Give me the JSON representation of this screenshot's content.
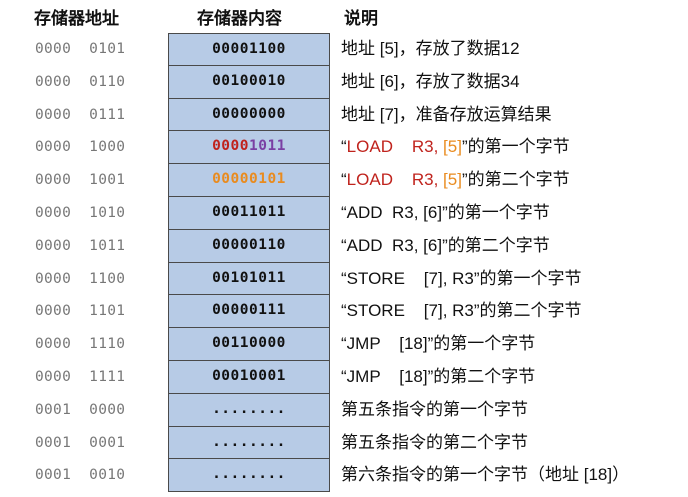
{
  "headers": {
    "address": "存储器地址",
    "content": "存储器内容",
    "description": "说明"
  },
  "rows": [
    {
      "addr": "0000  0101",
      "content": [
        "00001100"
      ],
      "desc": [
        "地址 [5]，存放了数据12"
      ]
    },
    {
      "addr": "0000  0110",
      "content": [
        "00100010"
      ],
      "desc": [
        "地址 [6]，存放了数据34"
      ]
    },
    {
      "addr": "0000  0111",
      "content": [
        "00000000"
      ],
      "desc": [
        "地址 [7]，准备存放运算结果"
      ]
    },
    {
      "addr": "0000  1000",
      "content": [
        "0000",
        "1011"
      ],
      "desc": [
        "“",
        "LOAD    R3, ",
        "[5]",
        "”的第一个字节"
      ]
    },
    {
      "addr": "0000  1001",
      "content": [
        "00000101"
      ],
      "desc": [
        "“",
        "LOAD    R3, ",
        "[5]",
        "”的第二个字节"
      ]
    },
    {
      "addr": "0000  1010",
      "content": [
        "00011011"
      ],
      "desc": [
        "“ADD  R3, [6]”的第一个字节"
      ]
    },
    {
      "addr": "0000  1011",
      "content": [
        "00000110"
      ],
      "desc": [
        "“ADD  R3, [6]”的第二个字节"
      ]
    },
    {
      "addr": "0000  1100",
      "content": [
        "00101011"
      ],
      "desc": [
        "“STORE    [7], R3”的第一个字节"
      ]
    },
    {
      "addr": "0000  1101",
      "content": [
        "00000111"
      ],
      "desc": [
        "“STORE    [7], R3”的第二个字节"
      ]
    },
    {
      "addr": "0000  1110",
      "content": [
        "00110000"
      ],
      "desc": [
        "“JMP    [18]”的第一个字节"
      ]
    },
    {
      "addr": "0000  1111",
      "content": [
        "00010001"
      ],
      "desc": [
        "“JMP    [18]”的第二个字节"
      ]
    },
    {
      "addr": "0001  0000",
      "content": [
        "........"
      ],
      "desc": [
        "第五条指令的第一个字节"
      ]
    },
    {
      "addr": "0001  0001",
      "content": [
        "........"
      ],
      "desc": [
        "第五条指令的第二个字节"
      ]
    },
    {
      "addr": "0001  0010",
      "content": [
        "........"
      ],
      "desc": [
        "第六条指令的第一个字节（地址 [18]）"
      ]
    }
  ],
  "colors": {
    "cell_fill": "#b7cbe6",
    "highlight_red": "#c0231d",
    "highlight_purple": "#7a3fa3",
    "highlight_orange": "#e98b1f"
  }
}
